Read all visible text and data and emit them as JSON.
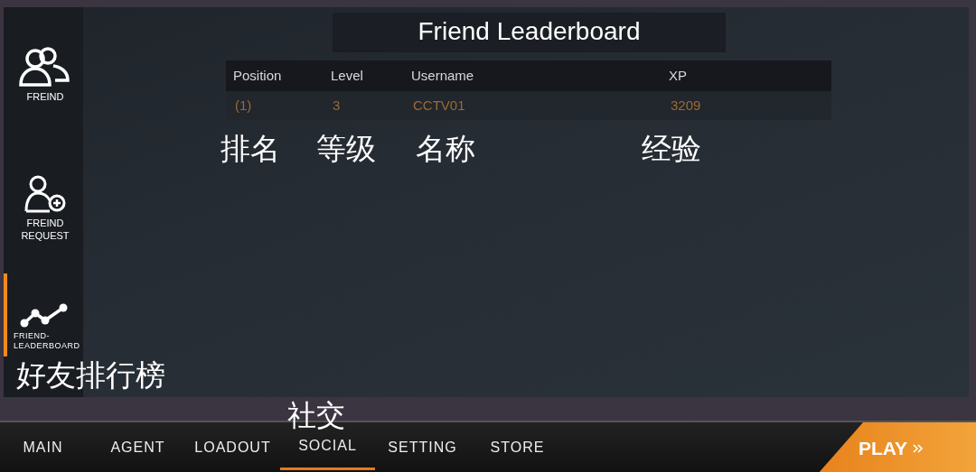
{
  "sidebar": {
    "items": [
      {
        "label": "FREIND",
        "kind": "friends",
        "selected": false
      },
      {
        "label": "FREIND REQUEST",
        "kind": "add-friend",
        "selected": false
      },
      {
        "label": "FRIEND-LEADERBOARD",
        "kind": "leaderboard",
        "selected": true
      }
    ],
    "annotation": "好友排行榜"
  },
  "leaderboard": {
    "title": "Friend Leaderboard",
    "columns": [
      "Position",
      "Level",
      "Username",
      "XP"
    ],
    "rows": [
      [
        "(1)",
        "3",
        "CCTV01",
        "3209"
      ]
    ],
    "annotations": [
      "排名",
      "等级",
      "名称",
      "经验"
    ]
  },
  "nav": {
    "tabs": [
      {
        "label": "MAIN",
        "selected": false
      },
      {
        "label": "AGENT",
        "selected": false
      },
      {
        "label": "LOADOUT",
        "selected": false
      },
      {
        "label": "SOCIAL",
        "selected": true
      },
      {
        "label": "SETTING",
        "selected": false
      },
      {
        "label": "STORE",
        "selected": false
      }
    ],
    "annotation": "社交",
    "play_button": "PLAY"
  }
}
